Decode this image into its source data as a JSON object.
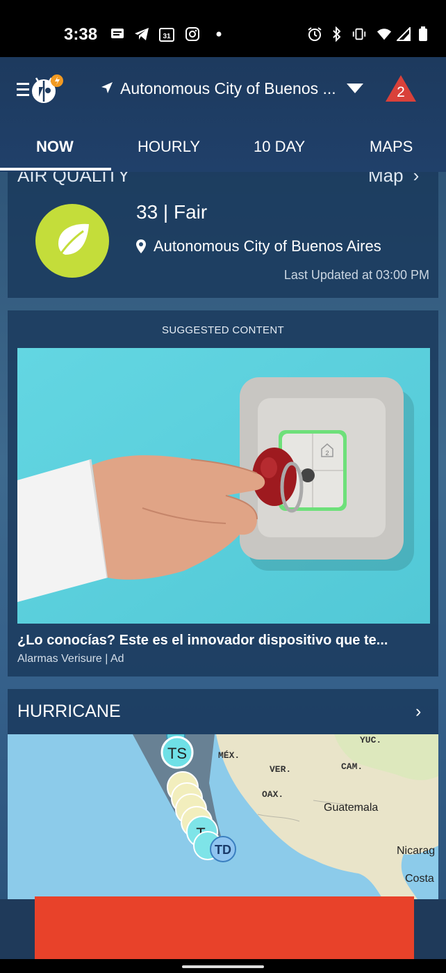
{
  "status_bar": {
    "time": "3:38",
    "left_icons": [
      "message-icon",
      "telegram-icon",
      "calendar-icon",
      "instagram-icon",
      "dot-icon"
    ],
    "calendar_number": "31",
    "right_icons": [
      "alarm-icon",
      "bluetooth-icon",
      "vibrate-icon",
      "wifi-icon",
      "signal-icon",
      "battery-icon"
    ]
  },
  "header": {
    "location": "Autonomous City of Buenos ...",
    "alert_count": "2",
    "alert_color": "#d9413a"
  },
  "tabs": [
    {
      "label": "NOW",
      "active": true
    },
    {
      "label": "HOURLY",
      "active": false
    },
    {
      "label": "10 DAY",
      "active": false
    },
    {
      "label": "MAPS",
      "active": false
    }
  ],
  "air_quality": {
    "header": "AIR QUALITY",
    "map_link": "Map",
    "value_text": "33 | Fair",
    "location": "Autonomous City of Buenos Aires",
    "updated": "Last Updated at 03:00 PM",
    "indicator_color": "#c4dd3a"
  },
  "suggested": {
    "label": "SUGGESTED CONTENT",
    "ad_title": "¿Lo conocías? Este es el innovador dispositivo que te...",
    "ad_sponsor": "Alarmas Verisure | Ad",
    "key_panel_number": "2"
  },
  "hurricane": {
    "header": "HURRICANE",
    "map_labels": {
      "mex": "MÉX.",
      "yuc": "YUC.",
      "ver": "VER.",
      "cam": "CAM.",
      "oax": "OAX.",
      "guatemala": "Guatemala",
      "nicaragua": "Nicarag",
      "costa": "Costa"
    },
    "storm_markers": [
      "TS",
      "T",
      "TD"
    ]
  },
  "banner_ad": {
    "color": "#e8422a"
  }
}
